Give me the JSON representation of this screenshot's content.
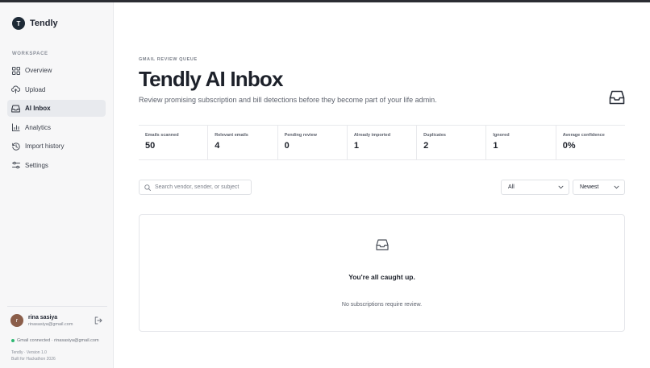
{
  "brand": {
    "name": "Tendly",
    "logo_letter": "T"
  },
  "sidebar": {
    "section_label": "WORKSPACE",
    "items": [
      {
        "label": "Overview",
        "icon": "grid-icon",
        "active": false
      },
      {
        "label": "Upload",
        "icon": "cloud-upload-icon",
        "active": false
      },
      {
        "label": "AI Inbox",
        "icon": "inbox-icon",
        "active": true
      },
      {
        "label": "Analytics",
        "icon": "bar-chart-icon",
        "active": false
      },
      {
        "label": "Import history",
        "icon": "history-icon",
        "active": false
      },
      {
        "label": "Settings",
        "icon": "sliders-icon",
        "active": false
      }
    ],
    "user": {
      "initial": "r",
      "name": "rina sasiya",
      "email": "rinasasiya@gmail.com"
    },
    "gmail_status": "Gmail connected · rinasasiya@gmail.com",
    "version": "Tendly · Version 1.0",
    "built_for": "Built for Hackathon 2026"
  },
  "main": {
    "eyebrow": "GMAIL REVIEW QUEUE",
    "title": "Tendly AI Inbox",
    "subtitle": "Review promising subscription and bill detections before they become part of your life admin.",
    "stats": [
      {
        "label": "Emails scanned",
        "value": "50"
      },
      {
        "label": "Relevant emails",
        "value": "4"
      },
      {
        "label": "Pending review",
        "value": "0"
      },
      {
        "label": "Already imported",
        "value": "1"
      },
      {
        "label": "Duplicates",
        "value": "2"
      },
      {
        "label": "Ignored",
        "value": "1"
      },
      {
        "label": "Average confidence",
        "value": "0%"
      }
    ],
    "search": {
      "placeholder": "Search vendor, sender, or subject",
      "value": ""
    },
    "filter": {
      "selected": "All"
    },
    "sort": {
      "selected": "Newest"
    },
    "empty_state": {
      "title": "You're all caught up.",
      "subtitle": "No subscriptions require review."
    }
  },
  "colors": {
    "accent_dark": "#1e2a36",
    "active_nav_bg": "#e8eaee",
    "status_green": "#2eb872",
    "avatar_bg": "#8b5e4a"
  }
}
